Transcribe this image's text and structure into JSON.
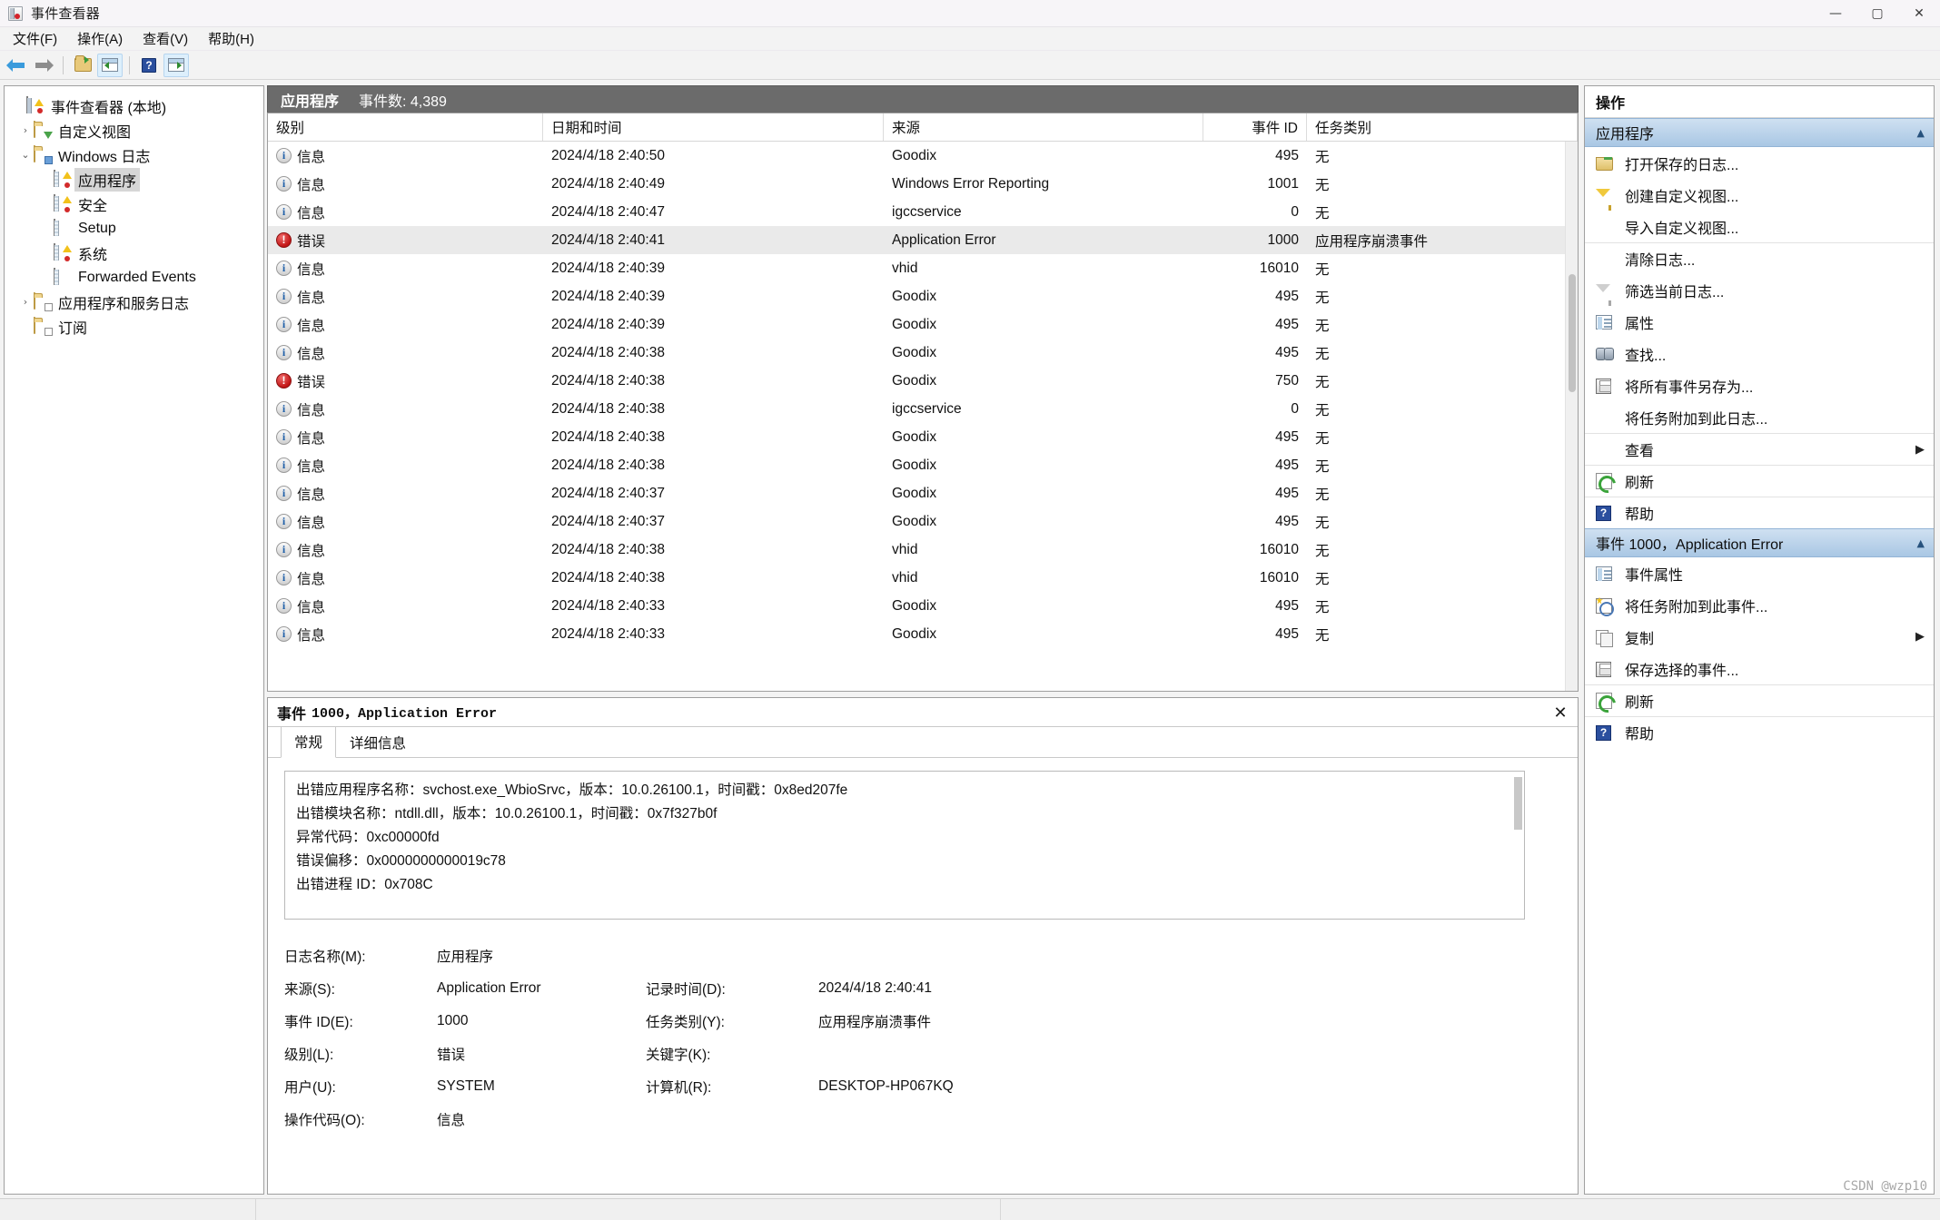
{
  "window": {
    "title": "事件查看器",
    "icon": "event-viewer-icon",
    "controls": {
      "minimize": "—",
      "maximize": "▢",
      "close": "✕"
    }
  },
  "menubar": [
    {
      "label": "文件(F)",
      "name": "menu-file"
    },
    {
      "label": "操作(A)",
      "name": "menu-action"
    },
    {
      "label": "查看(V)",
      "name": "menu-view"
    },
    {
      "label": "帮助(H)",
      "name": "menu-help"
    }
  ],
  "toolbar": [
    {
      "name": "back-arrow-icon"
    },
    {
      "name": "forward-arrow-icon"
    },
    {
      "name": "open-folder-icon"
    },
    {
      "name": "show-console-tree-icon"
    },
    {
      "name": "help-icon"
    },
    {
      "name": "show-action-pane-icon"
    }
  ],
  "tree": [
    {
      "label": "事件查看器 (本地)",
      "icon": "event-viewer-root-icon",
      "twisty": "",
      "indent": 0,
      "selected": false
    },
    {
      "label": "自定义视图",
      "icon": "custom-views-folder-icon",
      "twisty": "›",
      "indent": 1,
      "selected": false
    },
    {
      "label": "Windows 日志",
      "icon": "windows-logs-folder-icon",
      "twisty": "⌄",
      "indent": 1,
      "selected": false
    },
    {
      "label": "应用程序",
      "icon": "application-log-icon",
      "twisty": "",
      "indent": 2,
      "selected": true
    },
    {
      "label": "安全",
      "icon": "security-log-icon",
      "twisty": "",
      "indent": 2,
      "selected": false
    },
    {
      "label": "Setup",
      "icon": "setup-log-icon",
      "twisty": "",
      "indent": 2,
      "selected": false
    },
    {
      "label": "系统",
      "icon": "system-log-icon",
      "twisty": "",
      "indent": 2,
      "selected": false
    },
    {
      "label": "Forwarded Events",
      "icon": "forwarded-events-log-icon",
      "twisty": "",
      "indent": 2,
      "selected": false
    },
    {
      "label": "应用程序和服务日志",
      "icon": "apps-services-logs-folder-icon",
      "twisty": "›",
      "indent": 1,
      "selected": false
    },
    {
      "label": "订阅",
      "icon": "subscriptions-folder-icon",
      "twisty": "",
      "indent": 1,
      "selected": false
    }
  ],
  "list": {
    "header_title": "应用程序",
    "header_count": "事件数: 4,389",
    "columns": [
      "级别",
      "日期和时间",
      "来源",
      "事件 ID",
      "任务类别"
    ],
    "rows": [
      {
        "level": "信息",
        "level_icon": "information-icon",
        "datetime": "2024/4/18 2:40:50",
        "source": "Goodix",
        "event_id": "495",
        "task": "无",
        "selected": false
      },
      {
        "level": "信息",
        "level_icon": "information-icon",
        "datetime": "2024/4/18 2:40:49",
        "source": "Windows Error Reporting",
        "event_id": "1001",
        "task": "无",
        "selected": false
      },
      {
        "level": "信息",
        "level_icon": "information-icon",
        "datetime": "2024/4/18 2:40:47",
        "source": "igccservice",
        "event_id": "0",
        "task": "无",
        "selected": false
      },
      {
        "level": "错误",
        "level_icon": "error-icon",
        "datetime": "2024/4/18 2:40:41",
        "source": "Application Error",
        "event_id": "1000",
        "task": "应用程序崩溃事件",
        "selected": true
      },
      {
        "level": "信息",
        "level_icon": "information-icon",
        "datetime": "2024/4/18 2:40:39",
        "source": "vhid",
        "event_id": "16010",
        "task": "无",
        "selected": false
      },
      {
        "level": "信息",
        "level_icon": "information-icon",
        "datetime": "2024/4/18 2:40:39",
        "source": "Goodix",
        "event_id": "495",
        "task": "无",
        "selected": false
      },
      {
        "level": "信息",
        "level_icon": "information-icon",
        "datetime": "2024/4/18 2:40:39",
        "source": "Goodix",
        "event_id": "495",
        "task": "无",
        "selected": false
      },
      {
        "level": "信息",
        "level_icon": "information-icon",
        "datetime": "2024/4/18 2:40:38",
        "source": "Goodix",
        "event_id": "495",
        "task": "无",
        "selected": false
      },
      {
        "level": "错误",
        "level_icon": "error-icon",
        "datetime": "2024/4/18 2:40:38",
        "source": "Goodix",
        "event_id": "750",
        "task": "无",
        "selected": false
      },
      {
        "level": "信息",
        "level_icon": "information-icon",
        "datetime": "2024/4/18 2:40:38",
        "source": "igccservice",
        "event_id": "0",
        "task": "无",
        "selected": false
      },
      {
        "level": "信息",
        "level_icon": "information-icon",
        "datetime": "2024/4/18 2:40:38",
        "source": "Goodix",
        "event_id": "495",
        "task": "无",
        "selected": false
      },
      {
        "level": "信息",
        "level_icon": "information-icon",
        "datetime": "2024/4/18 2:40:38",
        "source": "Goodix",
        "event_id": "495",
        "task": "无",
        "selected": false
      },
      {
        "level": "信息",
        "level_icon": "information-icon",
        "datetime": "2024/4/18 2:40:37",
        "source": "Goodix",
        "event_id": "495",
        "task": "无",
        "selected": false
      },
      {
        "level": "信息",
        "level_icon": "information-icon",
        "datetime": "2024/4/18 2:40:37",
        "source": "Goodix",
        "event_id": "495",
        "task": "无",
        "selected": false
      },
      {
        "level": "信息",
        "level_icon": "information-icon",
        "datetime": "2024/4/18 2:40:38",
        "source": "vhid",
        "event_id": "16010",
        "task": "无",
        "selected": false
      },
      {
        "level": "信息",
        "level_icon": "information-icon",
        "datetime": "2024/4/18 2:40:38",
        "source": "vhid",
        "event_id": "16010",
        "task": "无",
        "selected": false
      },
      {
        "level": "信息",
        "level_icon": "information-icon",
        "datetime": "2024/4/18 2:40:33",
        "source": "Goodix",
        "event_id": "495",
        "task": "无",
        "selected": false
      },
      {
        "level": "信息",
        "level_icon": "information-icon",
        "datetime": "2024/4/18 2:40:33",
        "source": "Goodix",
        "event_id": "495",
        "task": "无",
        "selected": false
      }
    ]
  },
  "details": {
    "title_prefix": "事件",
    "title_rest": "1000，Application Error",
    "close_icon": "✕",
    "tabs": [
      {
        "label": "常规",
        "active": true
      },
      {
        "label": "详细信息",
        "active": false
      }
    ],
    "message_lines": [
      "出错应用程序名称：svchost.exe_WbioSrvc，版本：10.0.26100.1，时间戳：0x8ed207fe",
      "出错模块名称：ntdll.dll，版本：10.0.26100.1，时间戳：0x7f327b0f",
      "异常代码：0xc00000fd",
      "错误偏移：0x0000000000019c78",
      "出错进程 ID：0x708C"
    ],
    "meta": {
      "log_name_label": "日志名称(M):",
      "log_name_value": "应用程序",
      "source_label": "来源(S):",
      "source_value": "Application Error",
      "logged_label": "记录时间(D):",
      "logged_value": "2024/4/18 2:40:41",
      "event_id_label": "事件 ID(E):",
      "event_id_value": "1000",
      "task_label": "任务类别(Y):",
      "task_value": "应用程序崩溃事件",
      "level_label": "级别(L):",
      "level_value": "错误",
      "keywords_label": "关键字(K):",
      "keywords_value": "",
      "user_label": "用户(U):",
      "user_value": "SYSTEM",
      "computer_label": "计算机(R):",
      "computer_value": "DESKTOP-HP067KQ",
      "opcode_label": "操作代码(O):",
      "opcode_value": "信息"
    }
  },
  "actions": {
    "title": "操作",
    "group1": {
      "label": "应用程序",
      "caret": "▲"
    },
    "group1_items": [
      {
        "label": "打开保存的日志...",
        "icon": "open-saved-log-icon",
        "sep": false,
        "submenu": ""
      },
      {
        "label": "创建自定义视图...",
        "icon": "create-custom-view-icon",
        "sep": false,
        "submenu": ""
      },
      {
        "label": "导入自定义视图...",
        "icon": "",
        "sep": false,
        "submenu": ""
      },
      {
        "label": "清除日志...",
        "icon": "",
        "sep": true,
        "submenu": ""
      },
      {
        "label": "筛选当前日志...",
        "icon": "filter-current-log-icon",
        "sep": false,
        "submenu": ""
      },
      {
        "label": "属性",
        "icon": "properties-icon",
        "sep": false,
        "submenu": ""
      },
      {
        "label": "查找...",
        "icon": "find-icon",
        "sep": false,
        "submenu": ""
      },
      {
        "label": "将所有事件另存为...",
        "icon": "save-all-events-icon",
        "sep": false,
        "submenu": ""
      },
      {
        "label": "将任务附加到此日志...",
        "icon": "",
        "sep": false,
        "submenu": ""
      },
      {
        "label": "查看",
        "icon": "",
        "sep": true,
        "submenu": "▶"
      },
      {
        "label": "刷新",
        "icon": "refresh-icon",
        "sep": true,
        "submenu": ""
      },
      {
        "label": "帮助",
        "icon": "help-icon",
        "sep": true,
        "submenu": ""
      }
    ],
    "group2": {
      "label": "事件 1000，Application Error",
      "caret": "▲"
    },
    "group2_items": [
      {
        "label": "事件属性",
        "icon": "event-properties-icon",
        "sep": false,
        "submenu": ""
      },
      {
        "label": "将任务附加到此事件...",
        "icon": "attach-task-to-event-icon",
        "sep": false,
        "submenu": ""
      },
      {
        "label": "复制",
        "icon": "copy-icon",
        "sep": false,
        "submenu": "▶"
      },
      {
        "label": "保存选择的事件...",
        "icon": "save-selected-events-icon",
        "sep": false,
        "submenu": ""
      },
      {
        "label": "刷新",
        "icon": "refresh-icon",
        "sep": true,
        "submenu": ""
      },
      {
        "label": "帮助",
        "icon": "help-icon",
        "sep": true,
        "submenu": ""
      }
    ]
  },
  "statusbar": {
    "watermark": "CSDN @wzp10"
  }
}
